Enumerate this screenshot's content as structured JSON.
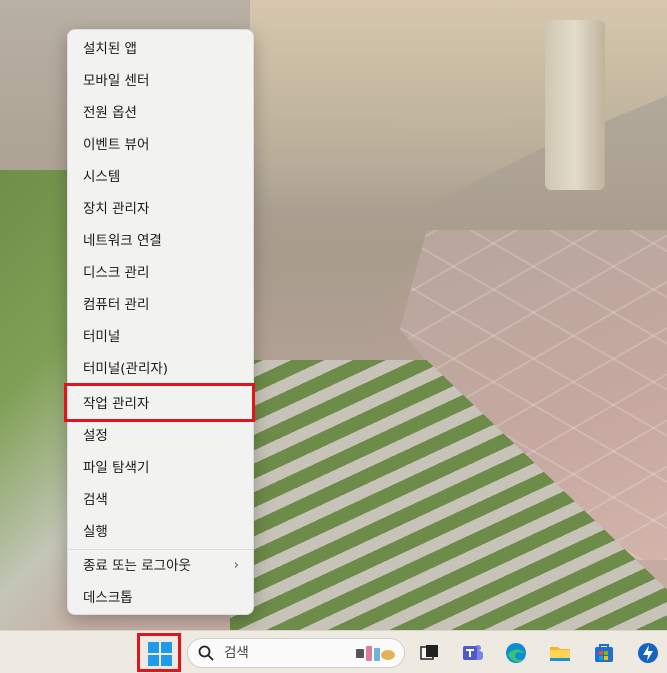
{
  "menu": {
    "items": [
      {
        "label": "설치된 앱"
      },
      {
        "label": "모바일 센터"
      },
      {
        "label": "전원 옵션"
      },
      {
        "label": "이벤트 뷰어"
      },
      {
        "label": "시스템"
      },
      {
        "label": "장치 관리자"
      },
      {
        "label": "네트워크 연결"
      },
      {
        "label": "디스크 관리"
      },
      {
        "label": "컴퓨터 관리"
      },
      {
        "label": "터미널"
      },
      {
        "label": "터미널(관리자)"
      },
      {
        "label": "작업 관리자",
        "highlighted": true
      },
      {
        "label": "설정"
      },
      {
        "label": "파일 탐색기"
      },
      {
        "label": "검색"
      },
      {
        "label": "실행"
      },
      {
        "label": "종료 또는 로그아웃",
        "submenu": true
      },
      {
        "label": "데스크톱"
      }
    ],
    "submenu_chevron": "›"
  },
  "taskbar": {
    "search_label": "검색",
    "icons": [
      "windows-start-icon",
      "search-icon",
      "task-view-icon",
      "teams-icon",
      "edge-icon",
      "file-explorer-icon",
      "store-icon",
      "quick-assist-icon"
    ]
  },
  "colors": {
    "highlight": "#e0151b",
    "accent": "#1f9be8"
  }
}
